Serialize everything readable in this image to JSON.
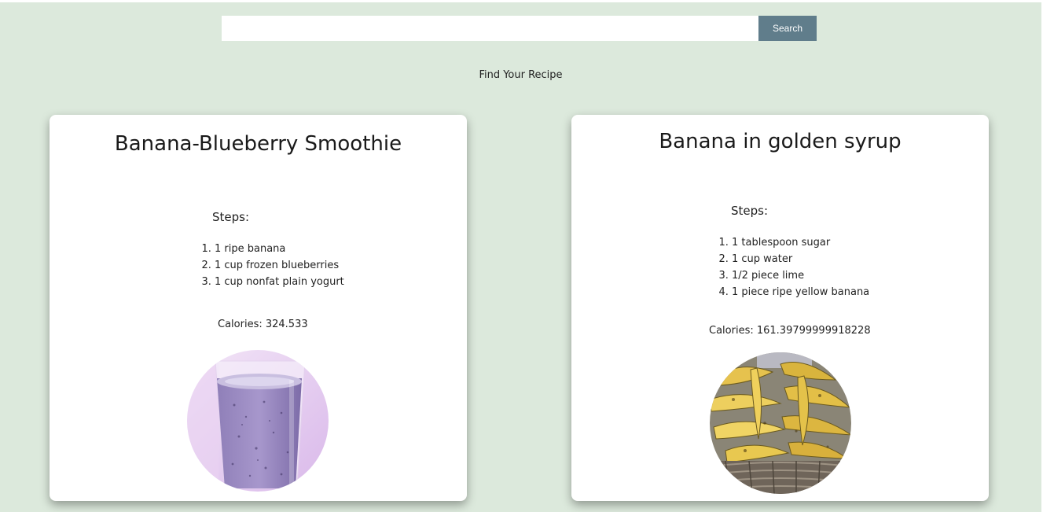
{
  "search": {
    "value": "",
    "placeholder": "",
    "button_label": "Search"
  },
  "tagline": "Find Your Recipe",
  "colors": {
    "background": "#dce9dc",
    "search_button": "#607d8b",
    "card": "#ffffff"
  },
  "recipes": [
    {
      "title": "Banana-Blueberry Smoothie",
      "steps_label": "Steps:",
      "steps": [
        "1 ripe banana",
        "1 cup frozen blueberries",
        "1 cup nonfat plain yogurt"
      ],
      "calories_label": "Calories: ",
      "calories": "324.533",
      "image": "smoothie-glass-photo"
    },
    {
      "title": "Banana in golden syrup",
      "steps_label": "Steps:",
      "steps": [
        "1 tablespoon sugar",
        "1 cup water",
        "1/2 piece lime",
        "1 piece ripe yellow banana"
      ],
      "calories_label": "Calories: ",
      "calories": "161.39799999918228",
      "image": "banana-basket-photo"
    }
  ]
}
